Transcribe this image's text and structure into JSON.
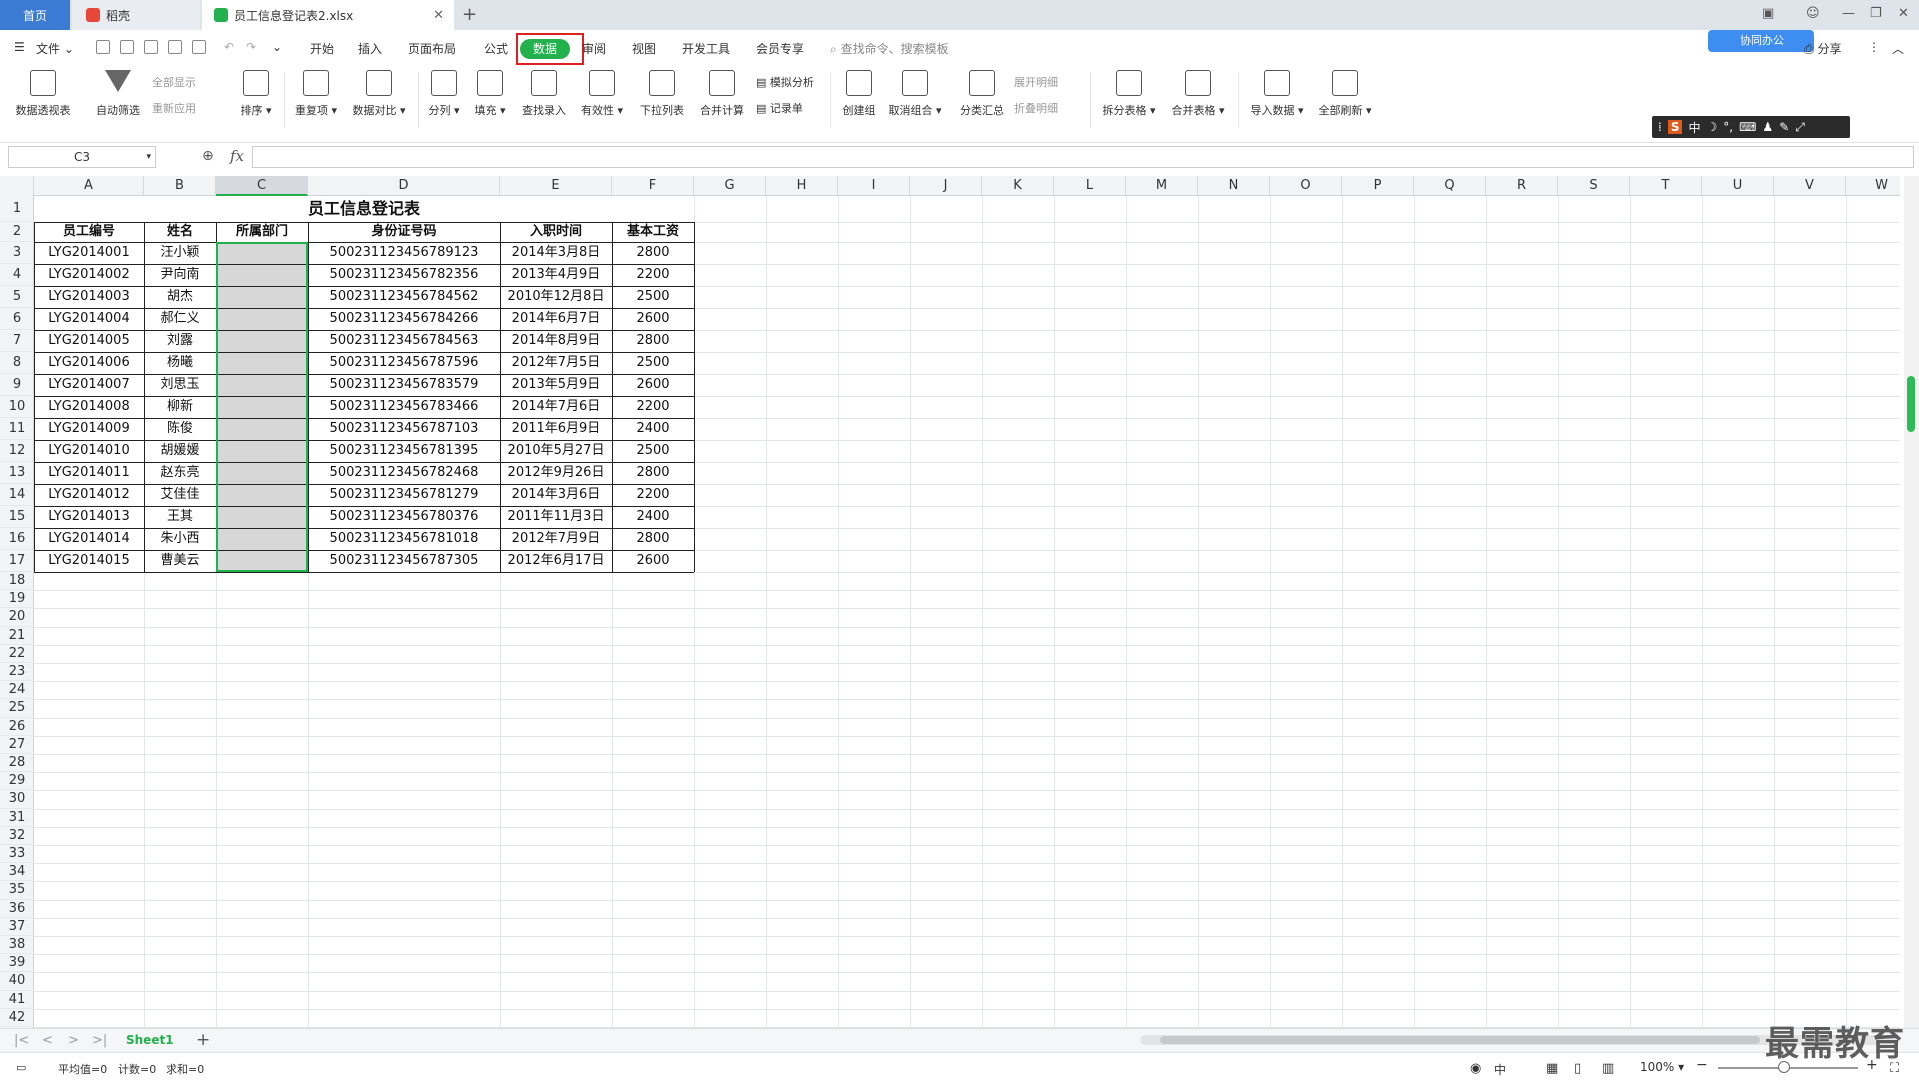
{
  "tabs": {
    "home": "首页",
    "daoke": "稻壳",
    "doc": "员工信息登记表2.xlsx"
  },
  "menu": {
    "file": "文件",
    "items": [
      "开始",
      "插入",
      "页面布局",
      "公式",
      "数据",
      "审阅",
      "视图",
      "开发工具",
      "会员专享"
    ],
    "search_placeholder": "查找命令、搜索模板",
    "cloud": "协同办公",
    "share": "分享"
  },
  "ribbon": {
    "pivot": "数据透视表",
    "autofilter": "自动筛选",
    "show_all": "全部显示",
    "reapply": "重新应用",
    "sort": "排序",
    "dup": "重复项",
    "compare": "数据对比",
    "split": "分列",
    "fill": "填充",
    "lookup": "查找录入",
    "validity": "有效性",
    "dropdown": "下拉列表",
    "merge_calc": "合并计算",
    "simulate": "模拟分析",
    "record": "记录单",
    "create_group": "创建组",
    "ungroup": "取消组合",
    "subtotal": "分类汇总",
    "expand": "展开明细",
    "collapse": "折叠明细",
    "split_table": "拆分表格",
    "merge_table": "合并表格",
    "import": "导入数据",
    "refresh_all": "全部刷新"
  },
  "ime": {
    "s": "S",
    "zh": "中"
  },
  "formula": {
    "namebox": "C3",
    "fx": "fx",
    "content": ""
  },
  "columns": [
    "A",
    "B",
    "C",
    "D",
    "E",
    "F",
    "G",
    "H",
    "I",
    "J",
    "K",
    "L",
    "M",
    "N",
    "O",
    "P",
    "Q",
    "R",
    "S",
    "T",
    "U",
    "V",
    "W"
  ],
  "table": {
    "title": "员工信息登记表",
    "headers": [
      "员工编号",
      "姓名",
      "所属部门",
      "身份证号码",
      "入职时间",
      "基本工资"
    ],
    "rows": [
      [
        "LYG2014001",
        "汪小颖",
        "",
        "500231123456789123",
        "2014年3月8日",
        "2800"
      ],
      [
        "LYG2014002",
        "尹向南",
        "",
        "500231123456782356",
        "2013年4月9日",
        "2200"
      ],
      [
        "LYG2014003",
        "胡杰",
        "",
        "500231123456784562",
        "2010年12月8日",
        "2500"
      ],
      [
        "LYG2014004",
        "郝仁义",
        "",
        "500231123456784266",
        "2014年6月7日",
        "2600"
      ],
      [
        "LYG2014005",
        "刘露",
        "",
        "500231123456784563",
        "2014年8月9日",
        "2800"
      ],
      [
        "LYG2014006",
        "杨曦",
        "",
        "500231123456787596",
        "2012年7月5日",
        "2500"
      ],
      [
        "LYG2014007",
        "刘思玉",
        "",
        "500231123456783579",
        "2013年5月9日",
        "2600"
      ],
      [
        "LYG2014008",
        "柳新",
        "",
        "500231123456783466",
        "2014年7月6日",
        "2200"
      ],
      [
        "LYG2014009",
        "陈俊",
        "",
        "500231123456787103",
        "2011年6月9日",
        "2400"
      ],
      [
        "LYG2014010",
        "胡媛媛",
        "",
        "500231123456781395",
        "2010年5月27日",
        "2500"
      ],
      [
        "LYG2014011",
        "赵东亮",
        "",
        "500231123456782468",
        "2012年9月26日",
        "2800"
      ],
      [
        "LYG2014012",
        "艾佳佳",
        "",
        "500231123456781279",
        "2014年3月6日",
        "2200"
      ],
      [
        "LYG2014013",
        "王其",
        "",
        "500231123456780376",
        "2011年11月3日",
        "2400"
      ],
      [
        "LYG2014014",
        "朱小西",
        "",
        "500231123456781018",
        "2012年7月9日",
        "2800"
      ],
      [
        "LYG2014015",
        "曹美云",
        "",
        "500231123456787305",
        "2012年6月17日",
        "2600"
      ]
    ]
  },
  "sheet_tab": "Sheet1",
  "status": {
    "avg": "平均值=0",
    "count": "计数=0",
    "sum": "求和=0",
    "zoom": "100%"
  },
  "watermark": "最需教育",
  "colors": {
    "accent_green": "#22b14c",
    "highlight_red": "#e02020",
    "tab_blue": "#3b7bd4"
  }
}
